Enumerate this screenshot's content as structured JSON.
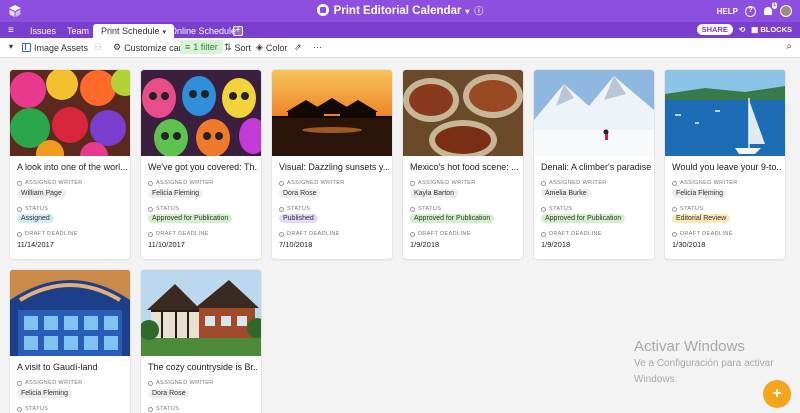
{
  "app": {
    "title": "Print Editorial Calendar",
    "help": "HELP",
    "notification_count": "1",
    "brand_color": "#8d4fe0"
  },
  "tabs": [
    "Issues",
    "Team",
    "Print Schedule",
    "Online Schedule"
  ],
  "tabbar_right": {
    "share": "SHARE",
    "blocks": "BLOCKS"
  },
  "toolbar": {
    "view_name": "Image Assets",
    "customize": "Customize cards",
    "filter": "1 filter",
    "sort": "Sort",
    "color": "Color",
    "more": "···"
  },
  "fields": {
    "writer": "ASSIGNED WRITER",
    "status": "STATUS",
    "deadline": "DRAFT DEADLINE"
  },
  "status_colors": {
    "Assigned": "#d0ecf8",
    "Approved for Publication": "#d1f2c9",
    "Published": "#e2d9fb",
    "Editorial Review": "#fde8b8"
  },
  "cards": [
    {
      "title": "A look into one of the worl...",
      "writer": "William Page",
      "status": "Assigned",
      "deadline": "11/14/2017",
      "image": "colored-powder-photo"
    },
    {
      "title": "We've got you covered: Th...",
      "writer": "Felicia Fleming",
      "status": "Approved for Publication",
      "deadline": "11/10/2017",
      "image": "sugar-skulls-photo"
    },
    {
      "title": "Visual: Dazzling sunsets y...",
      "writer": "Dora Rose",
      "status": "Published",
      "deadline": "7/10/2018",
      "image": "sunset-huts-photo"
    },
    {
      "title": "Mexico's hot food scene: ...",
      "writer": "Kayla Barton",
      "status": "Approved for Publication",
      "deadline": "1/9/2018",
      "image": "fried-insects-photo"
    },
    {
      "title": "Denali: A climber's paradise",
      "writer": "Amelia Burke",
      "status": "Approved for Publication",
      "deadline": "1/9/2018",
      "image": "snow-mountain-photo"
    },
    {
      "title": "Would you leave your 9-to...",
      "writer": "Felicia Fleming",
      "status": "Editorial Review",
      "deadline": "1/30/2018",
      "image": "sailboat-bay-photo"
    },
    {
      "title": "A visit to Gaudí-land",
      "writer": "Felicia Fleming",
      "status": "",
      "deadline": "",
      "image": "gaudi-ceiling-photo"
    },
    {
      "title": "The cozy countryside is Br...",
      "writer": "Dora Rose",
      "status": "",
      "deadline": "",
      "image": "tudor-house-photo"
    }
  ],
  "watermark": {
    "line1": "Activar Windows",
    "line2": "Ve a Configuración para activar",
    "line3": "Windows."
  },
  "fab": "+"
}
